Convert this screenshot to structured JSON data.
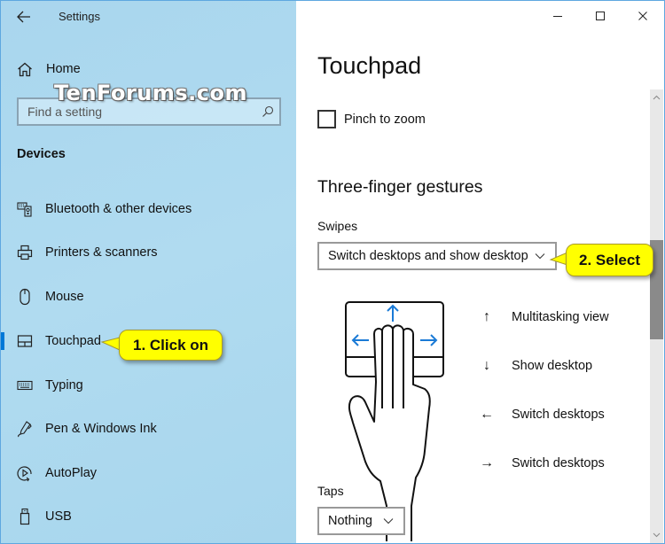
{
  "app": {
    "title": "Settings",
    "watermark": "TenForums.com"
  },
  "window_controls": {
    "minimize": "minimize-icon",
    "maximize": "maximize-icon",
    "close": "close-icon"
  },
  "sidebar": {
    "home_label": "Home",
    "search": {
      "placeholder": "Find a setting",
      "value": ""
    },
    "section_heading": "Devices",
    "items": [
      {
        "label": "Bluetooth & other devices",
        "icon": "bluetooth-devices-icon",
        "active": false
      },
      {
        "label": "Printers & scanners",
        "icon": "printer-icon",
        "active": false
      },
      {
        "label": "Mouse",
        "icon": "mouse-icon",
        "active": false
      },
      {
        "label": "Touchpad",
        "icon": "touchpad-icon",
        "active": true
      },
      {
        "label": "Typing",
        "icon": "keyboard-icon",
        "active": false
      },
      {
        "label": "Pen & Windows Ink",
        "icon": "pen-icon",
        "active": false
      },
      {
        "label": "AutoPlay",
        "icon": "autoplay-icon",
        "active": false
      },
      {
        "label": "USB",
        "icon": "usb-icon",
        "active": false
      }
    ]
  },
  "main": {
    "page_title": "Touchpad",
    "pinch_to_zoom": {
      "label": "Pinch to zoom",
      "checked": false
    },
    "three_finger": {
      "heading": "Three-finger gestures",
      "swipes_label": "Swipes",
      "swipes_value": "Switch desktops and show desktop",
      "gestures": [
        {
          "arrow": "↑",
          "label": "Multitasking view"
        },
        {
          "arrow": "↓",
          "label": "Show desktop"
        },
        {
          "arrow": "←",
          "label": "Switch desktops"
        },
        {
          "arrow": "→",
          "label": "Switch desktops"
        }
      ],
      "taps_label": "Taps",
      "taps_value": "Nothing"
    }
  },
  "callouts": {
    "step1": "1. Click on",
    "step2": "2. Select"
  },
  "colors": {
    "accent": "#0078d7",
    "sidebar_bg": "#aed9ef",
    "callout_bg": "#ffff00",
    "scroll_thumb": "#8a8a8a"
  }
}
